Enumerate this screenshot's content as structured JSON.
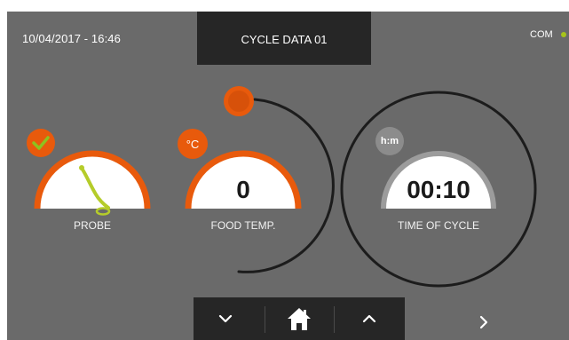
{
  "header": {
    "datetime": "10/04/2017 - 16:46",
    "title": "CYCLE DATA 01",
    "com_label": "COM"
  },
  "gauges": {
    "probe": {
      "label": "PROBE",
      "status_icon": "check-icon",
      "graphic": "probe-icon"
    },
    "food_temp": {
      "label": "FOOD TEMP.",
      "value": "0",
      "unit": "°C",
      "slider_knob_color": "#e85a0c"
    },
    "time_of_cycle": {
      "label": "TIME OF CYCLE",
      "value": "00:10",
      "unit": "h:m"
    }
  },
  "navigation": {
    "down_icon": "chevron-down-icon",
    "home_icon": "home-icon",
    "up_icon": "chevron-up-icon",
    "next_icon": "chevron-right-icon"
  },
  "colors": {
    "background": "#6a6a6a",
    "accent_orange": "#e85a0c",
    "dark_bar": "#262626",
    "probe_green": "#b5cc2a",
    "com_status": "#a8c41a"
  }
}
